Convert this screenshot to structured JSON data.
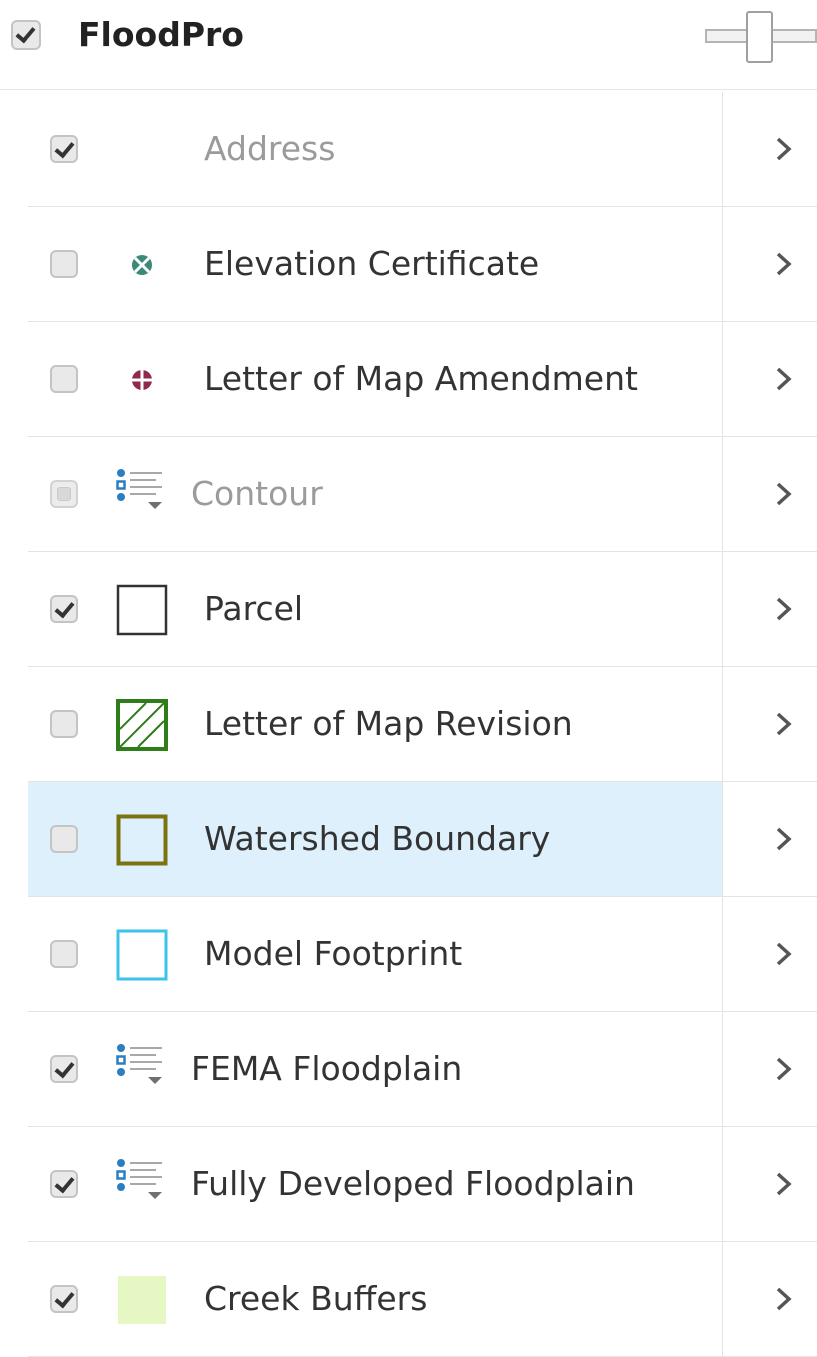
{
  "header": {
    "title": "FloodPro",
    "checked": true
  },
  "layers": [
    {
      "label": "Address",
      "checked": true,
      "dim": true,
      "symbol": "none-icon"
    },
    {
      "label": "Elevation Certificate",
      "checked": false,
      "symbol": "teal-point-marker-icon",
      "color": "#3a8a78"
    },
    {
      "label": "Letter of Map Amendment",
      "checked": false,
      "symbol": "maroon-point-marker-icon",
      "color": "#8e2a4c"
    },
    {
      "label": "Contour",
      "checked": false,
      "dim": true,
      "symbol": "legend-list-icon"
    },
    {
      "label": "Parcel",
      "checked": true,
      "symbol": "black-outline-square-icon",
      "color": "#333333"
    },
    {
      "label": "Letter of Map Revision",
      "checked": false,
      "symbol": "green-hatched-square-icon",
      "color": "#2f7d1a"
    },
    {
      "label": "Watershed Boundary",
      "checked": false,
      "selected": true,
      "symbol": "olive-outline-square-icon",
      "color": "#7a7410"
    },
    {
      "label": "Model Footprint",
      "checked": false,
      "symbol": "cyan-outline-square-icon",
      "color": "#3ec3e8"
    },
    {
      "label": "FEMA Floodplain",
      "checked": true,
      "symbol": "legend-list-icon"
    },
    {
      "label": "Fully Developed Floodplain",
      "checked": true,
      "symbol": "legend-list-icon"
    },
    {
      "label": "Creek Buffers",
      "checked": true,
      "symbol": "light-green-fill-square-icon",
      "color": "#e5f7c3"
    }
  ],
  "colors": {
    "selected_row": "#ddf0fb",
    "legend_blue": "#2b7ec1"
  }
}
